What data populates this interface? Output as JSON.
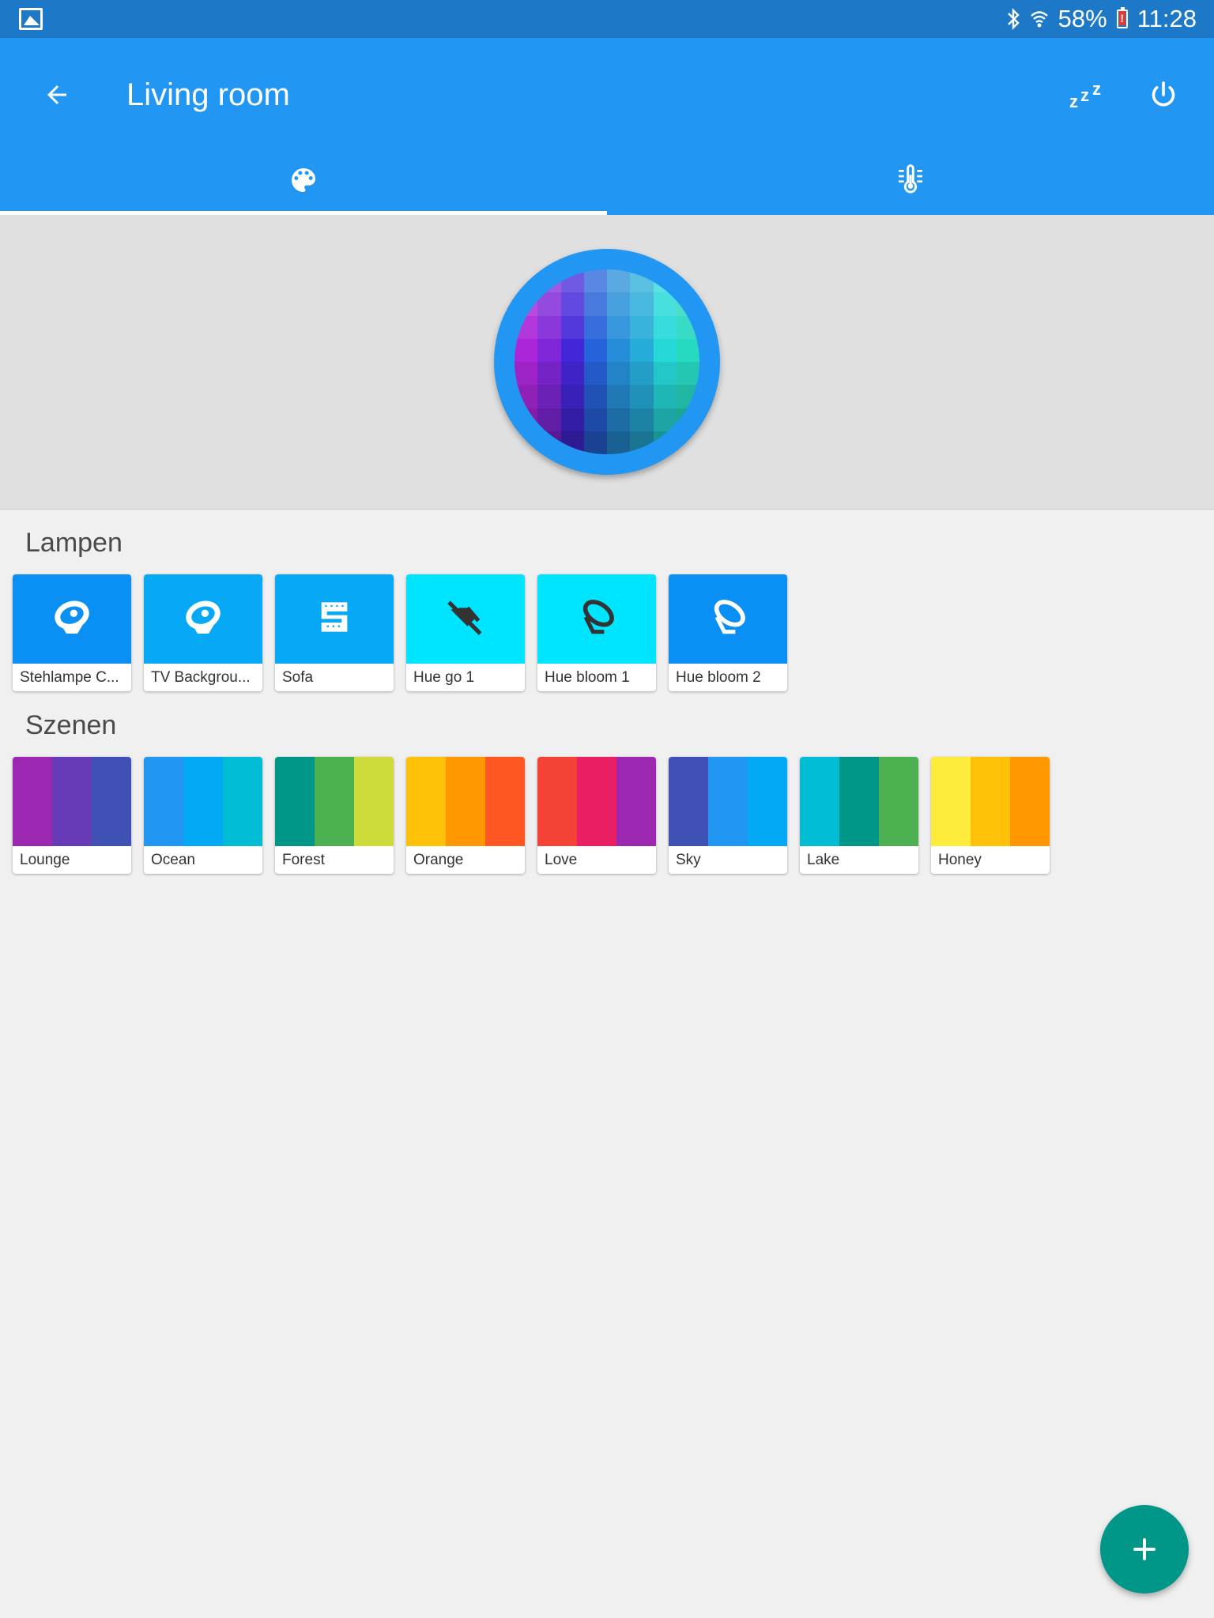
{
  "status_bar": {
    "battery": "58%",
    "time": "11:28"
  },
  "app_bar": {
    "title": "Living room",
    "sleep_label": "zzz"
  },
  "tabs": [
    {
      "icon": "palette-icon",
      "selected": true
    },
    {
      "icon": "thermometer-icon",
      "selected": false
    }
  ],
  "colors": {
    "primary": "#2196f3",
    "status_bar": "#1d79c8",
    "fab": "#009688"
  },
  "sections": {
    "lamps_title": "Lampen",
    "scenes_title": "Szenen"
  },
  "lamps": [
    {
      "label": "Stehlampe C...",
      "color": "#0a8ff5",
      "icon": "floor-lamp-icon"
    },
    {
      "label": "TV Backgrou...",
      "color": "#07a9f7",
      "icon": "floor-lamp-icon"
    },
    {
      "label": "Sofa",
      "color": "#07a9f7",
      "icon": "lightstrip-icon"
    },
    {
      "label": "Hue go 1",
      "color": "#00e5ff",
      "icon": "lamp-off-icon"
    },
    {
      "label": "Hue bloom 1",
      "color": "#00e5ff",
      "icon": "bloom-lamp-icon"
    },
    {
      "label": "Hue bloom 2",
      "color": "#0a8ff5",
      "icon": "bloom-lamp-icon"
    }
  ],
  "scenes": [
    {
      "label": "Lounge",
      "colors": [
        "#9c27b0",
        "#673ab7",
        "#3f51b5"
      ]
    },
    {
      "label": "Ocean",
      "colors": [
        "#2196f3",
        "#03a9f4",
        "#00bcd4"
      ]
    },
    {
      "label": "Forest",
      "colors": [
        "#009688",
        "#4caf50",
        "#cddc39"
      ]
    },
    {
      "label": "Orange",
      "colors": [
        "#ffc107",
        "#ff9800",
        "#ff5722"
      ]
    },
    {
      "label": "Love",
      "colors": [
        "#f44336",
        "#e91e63",
        "#9c27b0"
      ]
    },
    {
      "label": "Sky",
      "colors": [
        "#3f51b5",
        "#2196f3",
        "#03a9f4"
      ]
    },
    {
      "label": "Lake",
      "colors": [
        "#00bcd4",
        "#009688",
        "#4caf50"
      ]
    },
    {
      "label": "Honey",
      "colors": [
        "#ffeb3b",
        "#ffc107",
        "#ff9800"
      ]
    }
  ]
}
